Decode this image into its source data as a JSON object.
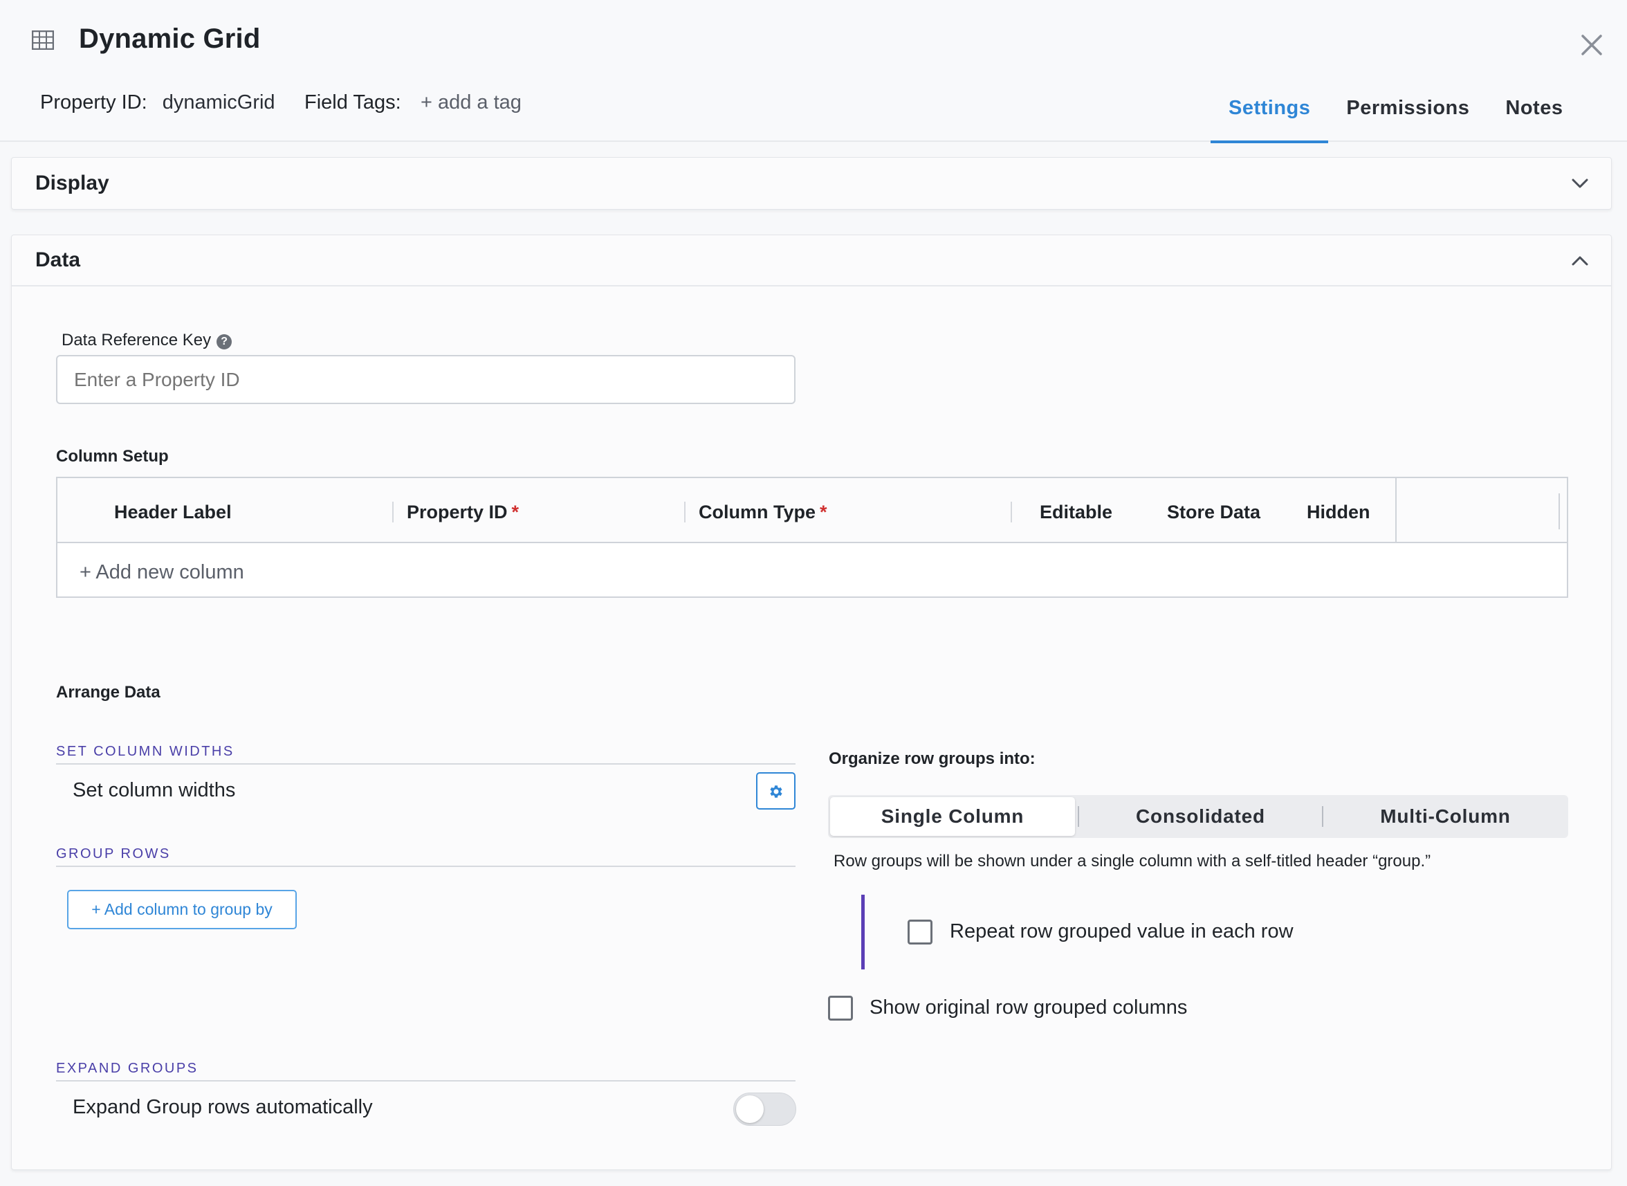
{
  "header": {
    "title": "Dynamic Grid",
    "property_id_label": "Property ID:",
    "property_id_value": "dynamicGrid",
    "field_tags_label": "Field Tags:",
    "add_tag": "+ add a tag",
    "tabs": [
      {
        "label": "Settings",
        "active": true
      },
      {
        "label": "Permissions",
        "active": false
      },
      {
        "label": "Notes",
        "active": false
      }
    ]
  },
  "display_panel": {
    "title": "Display",
    "expanded": false
  },
  "data_panel": {
    "title": "Data",
    "expanded": true,
    "data_reference_key": {
      "label": "Data Reference Key",
      "help": "?",
      "placeholder": "Enter a Property ID",
      "value": ""
    },
    "column_setup": {
      "title": "Column Setup",
      "headers": [
        "Header Label",
        "Property ID",
        "Column Type",
        "Editable",
        "Store Data",
        "Hidden"
      ],
      "required_mark": "*",
      "add_column": "+ Add new column"
    },
    "arrange_data": {
      "title": "Arrange Data",
      "set_column_widths": {
        "section": "SET COLUMN WIDTHS",
        "label": "Set column widths"
      },
      "group_rows": {
        "section": "GROUP ROWS",
        "button": "+ Add column to group by"
      },
      "expand_groups": {
        "section": "EXPAND GROUPS",
        "label": "Expand Group rows automatically",
        "enabled": false
      },
      "organize": {
        "label": "Organize row groups into:",
        "options": [
          "Single Column",
          "Consolidated",
          "Multi-Column"
        ],
        "selected": "Single Column",
        "description": "Row groups will be shown under a single column with a self-titled header “group.”",
        "repeat_value": {
          "label": "Repeat row grouped value in each row",
          "checked": false
        },
        "show_original": {
          "label": "Show original row grouped columns",
          "checked": false
        }
      }
    }
  },
  "colors": {
    "accent": "#2f86d6",
    "section_label": "#4a3fa8",
    "required": "#d0302f",
    "indent_bar": "#5b3fb6"
  },
  "icons": [
    "grid-icon",
    "close-icon",
    "chevron-down-icon",
    "chevron-up-icon",
    "help-icon",
    "plus-icon",
    "gear-icon"
  ]
}
